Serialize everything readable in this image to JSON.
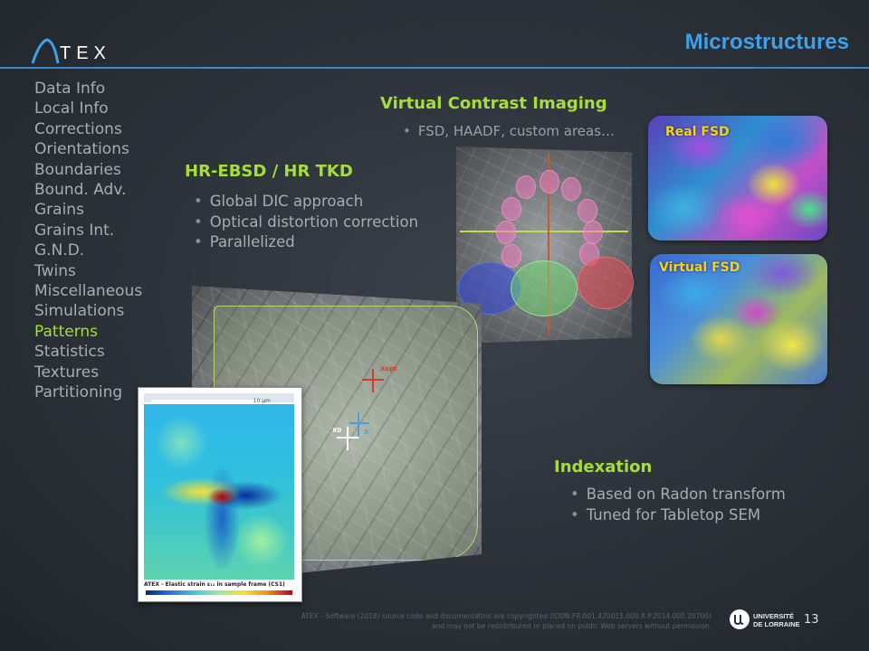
{
  "header": {
    "logo_text": "TEX",
    "title": "Microstructures"
  },
  "menu": {
    "items": [
      {
        "label": "Data Info",
        "active": false
      },
      {
        "label": "Local Info",
        "active": false
      },
      {
        "label": "Corrections",
        "active": false
      },
      {
        "label": "Orientations",
        "active": false
      },
      {
        "label": "Boundaries",
        "active": false
      },
      {
        "label": "Bound. Adv.",
        "active": false
      },
      {
        "label": "Grains",
        "active": false
      },
      {
        "label": "Grains Int.",
        "active": false
      },
      {
        "label": "G.N.D.",
        "active": false
      },
      {
        "label": "Twins",
        "active": false
      },
      {
        "label": "Miscellaneous",
        "active": false
      },
      {
        "label": "Simulations",
        "active": false
      },
      {
        "label": "Patterns",
        "active": true
      },
      {
        "label": "Statistics",
        "active": false
      },
      {
        "label": "Textures",
        "active": false
      },
      {
        "label": "Partitioning",
        "active": false
      }
    ]
  },
  "sections": {
    "virtual_contrast": {
      "heading": "Virtual Contrast Imaging",
      "bullets": [
        "FSD, HAADF, custom areas…"
      ]
    },
    "hr_ebsd": {
      "heading": "HR-EBSD / HR TKD",
      "bullets": [
        "Global DIC approach",
        "Optical distortion correction",
        "Parallelized"
      ]
    },
    "indexation": {
      "heading": "Indexation",
      "bullets": [
        "Based on Radon transform",
        "Tuned for Tabletop SEM"
      ]
    }
  },
  "images": {
    "pattern": {
      "label_xopt": "Xopt",
      "label_x0": "X0",
      "label_x": "X"
    },
    "strain_map": {
      "scale_label": "10 µm",
      "caption": "ATEX - Elastic strain ε₁₁ in sample frame (CS1)"
    },
    "real_fsd_label": "Real FSD",
    "virtual_fsd_label": "Virtual FSD"
  },
  "footer": {
    "copyright_line1": "ATEX - Software (2018) source code and documentation are copyrighted (IDDN.FR.001.420015.000.R.P.2014.000.20700)",
    "copyright_line2": "and may not be redistributed or placed on public Web servers without permission.",
    "university_line1": "UNIVERSITÉ",
    "university_line2": "DE LORRAINE",
    "page_number": "13"
  },
  "colors": {
    "accent_blue": "#3fa0e8",
    "accent_green": "#a6dd3a",
    "fsd_label_yellow": "#f5d21a"
  }
}
